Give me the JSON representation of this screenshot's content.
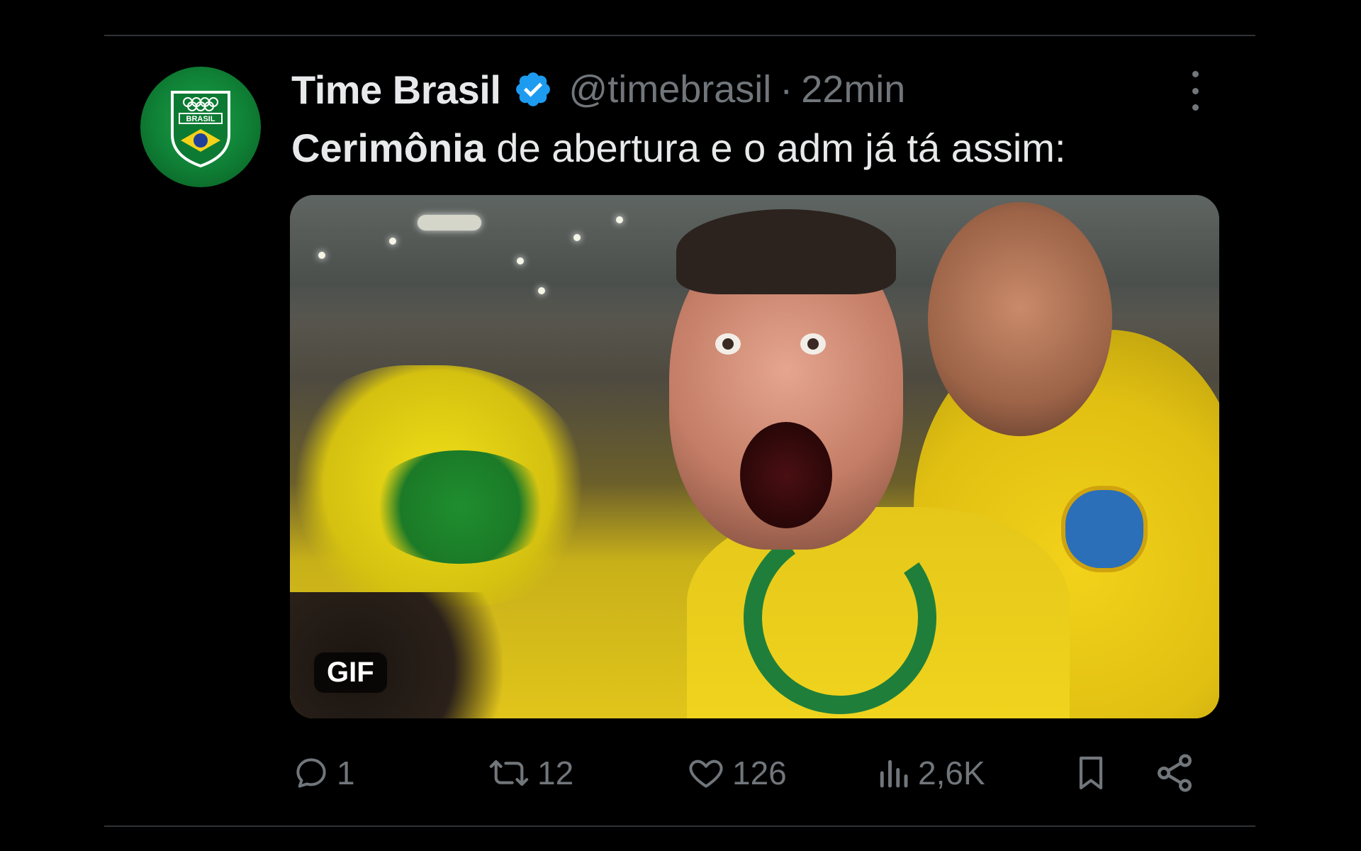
{
  "tweet": {
    "author_name": "Time Brasil",
    "handle": "@timebrasil",
    "separator": "·",
    "time": "22min",
    "text_bold": "Cerimônia",
    "text_rest": " de abertura e o adm já tá assim:",
    "avatar_label": "BRASIL",
    "media_badge": "GIF"
  },
  "actions": {
    "replies": "1",
    "reposts": "12",
    "likes": "126",
    "views": "2,6K"
  },
  "colors": {
    "background": "#000000",
    "text": "#e7e9ea",
    "secondary": "#71767b",
    "verified": "#1d9bf0",
    "avatar_green": "#0f7f35"
  },
  "icons": [
    "verified-badge-icon",
    "more-icon",
    "reply-icon",
    "repost-icon",
    "like-icon",
    "views-icon",
    "bookmark-icon",
    "share-icon"
  ]
}
